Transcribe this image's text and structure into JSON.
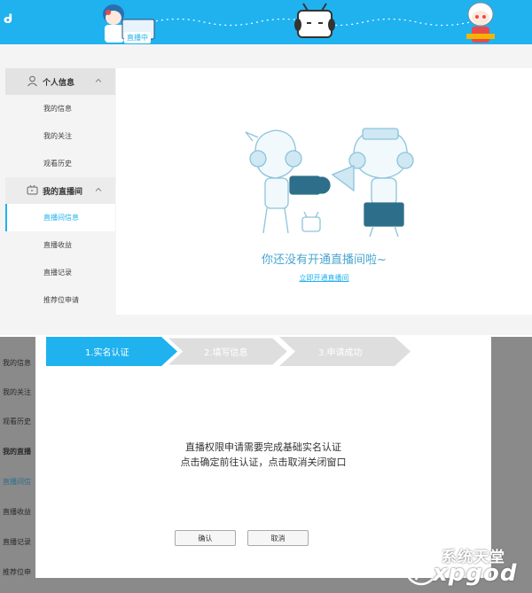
{
  "banner": {
    "live_tag": "直播中",
    "accent": "#1fb2ef"
  },
  "sidebar": {
    "section1": {
      "title": "个人信息",
      "icon": "user-icon"
    },
    "section1_items": [
      "我的信息",
      "我的关注",
      "观看历史"
    ],
    "section2": {
      "title": "我的直播间",
      "icon": "tv-icon"
    },
    "section2_items": [
      "直播间信息",
      "直播收益",
      "直播记录",
      "推荐位申请"
    ],
    "active_item": "直播间信息"
  },
  "main": {
    "empty_text": "你还没有开通直播间啦~",
    "open_link": "立即开通直播间"
  },
  "dim_sidebar": [
    "我的信息",
    "我的关注",
    "观看历史",
    "我的直播",
    "直播间信",
    "直播收益",
    "直播记录",
    "推荐位申"
  ],
  "modal": {
    "steps": [
      "1.实名认证",
      "2.填写信息",
      "3.申请成功"
    ],
    "active_step": 1,
    "message_line1": "直播权限申请需要完成基础实名认证",
    "message_line2": "点击确定前往认证，点击取消关闭窗口",
    "confirm_label": "确认",
    "cancel_label": "取消"
  },
  "watermark": {
    "line1": "系统天堂",
    "line2": "xpgod"
  }
}
